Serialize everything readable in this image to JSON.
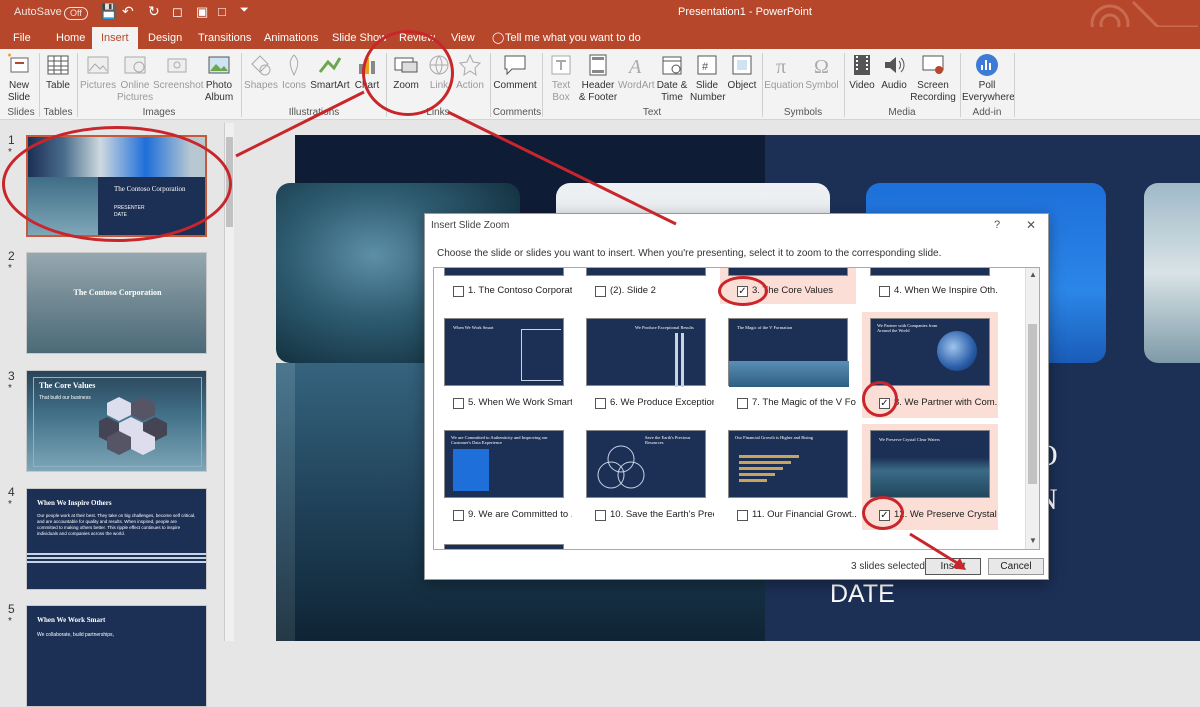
{
  "titlebar": {
    "autosave_label": "AutoSave",
    "autosave_state": "Off",
    "title": "Presentation1  -  PowerPoint"
  },
  "tabs": [
    {
      "label": "File"
    },
    {
      "label": "Home"
    },
    {
      "label": "Insert"
    },
    {
      "label": "Design"
    },
    {
      "label": "Transitions"
    },
    {
      "label": "Animations"
    },
    {
      "label": "Slide Show"
    },
    {
      "label": "Review"
    },
    {
      "label": "View"
    }
  ],
  "tell_me": "Tell me what you want to do",
  "ribbon": {
    "groups": [
      "Slides",
      "Tables",
      "Images",
      "Illustrations",
      "Links",
      "Comments",
      "Text",
      "Symbols",
      "Media",
      "Add-in"
    ],
    "buttons": {
      "new_slide": "New Slide",
      "table": "Table",
      "pictures": "Pictures",
      "online_pictures": "Online Pictures",
      "screenshot": "Screenshot",
      "photo_album": "Photo Album",
      "shapes": "Shapes",
      "icons": "Icons",
      "smartart": "SmartArt",
      "chart": "Chart",
      "zoom": "Zoom",
      "link": "Link",
      "action": "Action",
      "comment": "Comment",
      "text_box": "Text Box",
      "header_footer": "Header & Footer",
      "wordart": "WordArt",
      "date_time": "Date & Time",
      "slide_number": "Slide Number",
      "object": "Object",
      "equation": "Equation",
      "symbol": "Symbol",
      "video": "Video",
      "audio": "Audio",
      "screen_recording": "Screen Recording",
      "poll": "Poll Everywhere"
    }
  },
  "thumbnails": [
    {
      "num": "1",
      "title": "The Contoso Corporation",
      "sub1": "PRESENTER",
      "sub2": "DATE"
    },
    {
      "num": "2",
      "title": "The Contoso Corporation"
    },
    {
      "num": "3",
      "title": "The Core Values",
      "sub1": "That build our business"
    },
    {
      "num": "4",
      "title": "When We Inspire Others",
      "sub1": "Our people work at their best. They take on big challenges, become self critical, and are accountable for quality and results. When inspired, people are committed to making others better. This ripple effect continues to inspire individuals and companies across the world."
    },
    {
      "num": "5",
      "title": "When We Work Smart",
      "sub1": "We collaborate, build partnerships,"
    }
  ],
  "stage": {
    "date_text": "DATE",
    "partial_letters": [
      "O",
      "N"
    ]
  },
  "dialog": {
    "title": "Insert Slide Zoom",
    "help": "?",
    "close": "✕",
    "instruction": "Choose the slide or slides you want to insert. When you're presenting, select it to zoom to the corresponding slide.",
    "top_row": [
      {
        "label": "1. The Contoso Corporat...",
        "checked": false
      },
      {
        "label": "(2). Slide 2",
        "checked": false
      },
      {
        "label": "3. The Core Values",
        "checked": true
      },
      {
        "label": "4. When We Inspire Oth...",
        "checked": false
      }
    ],
    "rows": [
      [
        {
          "label": "5. When We Work Smart",
          "checked": false,
          "mini": "When We Work Smart"
        },
        {
          "label": "6. We Produce Exception...",
          "checked": false,
          "mini": "We Produce Exceptional Results"
        },
        {
          "label": "7. The Magic of the V Fo...",
          "checked": false,
          "mini": "The Magic of the V Formation"
        },
        {
          "label": "8. We Partner with Com...",
          "checked": true,
          "mini": "We Partner with Companies from Around the World"
        }
      ],
      [
        {
          "label": "9.  We are Committed to ...",
          "checked": false,
          "mini": "We are Committed to Authenticity and Improving our Customer's Data Experience"
        },
        {
          "label": "10. Save the Earth's Preci...",
          "checked": false,
          "mini": "Save the Earth's Precious Resources"
        },
        {
          "label": "11. Our Financial Growt...",
          "checked": false,
          "mini": "Our Financial Growth is Higher and Rising"
        },
        {
          "label": "12. We Preserve Crystal C...",
          "checked": true,
          "mini": "We Preserve Crystal Clear Waters"
        }
      ]
    ],
    "status": "3 slides selected",
    "insert_label": "Insert",
    "cancel_label": "Cancel"
  },
  "colors": {
    "accent": "#b7472a",
    "annotation": "#c8262b",
    "slide_navy": "#1c2f55",
    "selected_cell": "#fbded6"
  }
}
